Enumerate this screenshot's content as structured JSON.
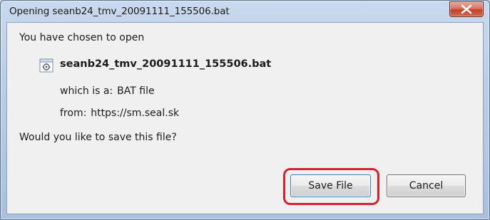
{
  "window": {
    "title": "Opening seanb24_tmv_20091111_155506.bat",
    "close_icon": "close-icon"
  },
  "dialog": {
    "intro": "You have chosen to open",
    "file_icon": "bat-file-icon",
    "file_name": "seanb24_tmv_20091111_155506.bat",
    "type_label": "which is a:",
    "type_value": "BAT file",
    "from_label": "from:",
    "from_value": "https://sm.seal.sk",
    "question": "Would you like to save this file?"
  },
  "buttons": {
    "save_label": "Save File",
    "cancel_label": "Cancel"
  },
  "annotation": {
    "highlight_color": "#d4232e"
  }
}
